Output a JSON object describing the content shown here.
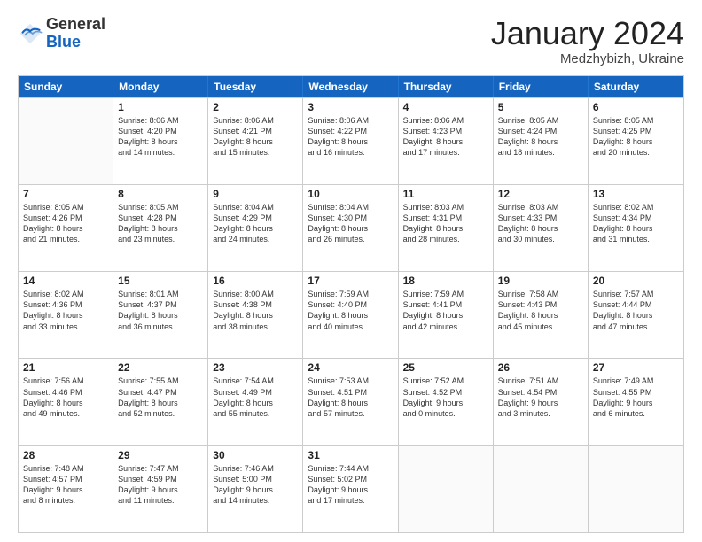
{
  "header": {
    "logo_general": "General",
    "logo_blue": "Blue",
    "month_title": "January 2024",
    "location": "Medzhybizh, Ukraine"
  },
  "days_of_week": [
    "Sunday",
    "Monday",
    "Tuesday",
    "Wednesday",
    "Thursday",
    "Friday",
    "Saturday"
  ],
  "weeks": [
    [
      {
        "day": "",
        "empty": true
      },
      {
        "day": "1",
        "sunrise": "Sunrise: 8:06 AM",
        "sunset": "Sunset: 4:20 PM",
        "daylight": "Daylight: 8 hours",
        "daylight2": "and 14 minutes."
      },
      {
        "day": "2",
        "sunrise": "Sunrise: 8:06 AM",
        "sunset": "Sunset: 4:21 PM",
        "daylight": "Daylight: 8 hours",
        "daylight2": "and 15 minutes."
      },
      {
        "day": "3",
        "sunrise": "Sunrise: 8:06 AM",
        "sunset": "Sunset: 4:22 PM",
        "daylight": "Daylight: 8 hours",
        "daylight2": "and 16 minutes."
      },
      {
        "day": "4",
        "sunrise": "Sunrise: 8:06 AM",
        "sunset": "Sunset: 4:23 PM",
        "daylight": "Daylight: 8 hours",
        "daylight2": "and 17 minutes."
      },
      {
        "day": "5",
        "sunrise": "Sunrise: 8:05 AM",
        "sunset": "Sunset: 4:24 PM",
        "daylight": "Daylight: 8 hours",
        "daylight2": "and 18 minutes."
      },
      {
        "day": "6",
        "sunrise": "Sunrise: 8:05 AM",
        "sunset": "Sunset: 4:25 PM",
        "daylight": "Daylight: 8 hours",
        "daylight2": "and 20 minutes."
      }
    ],
    [
      {
        "day": "7",
        "sunrise": "Sunrise: 8:05 AM",
        "sunset": "Sunset: 4:26 PM",
        "daylight": "Daylight: 8 hours",
        "daylight2": "and 21 minutes."
      },
      {
        "day": "8",
        "sunrise": "Sunrise: 8:05 AM",
        "sunset": "Sunset: 4:28 PM",
        "daylight": "Daylight: 8 hours",
        "daylight2": "and 23 minutes."
      },
      {
        "day": "9",
        "sunrise": "Sunrise: 8:04 AM",
        "sunset": "Sunset: 4:29 PM",
        "daylight": "Daylight: 8 hours",
        "daylight2": "and 24 minutes."
      },
      {
        "day": "10",
        "sunrise": "Sunrise: 8:04 AM",
        "sunset": "Sunset: 4:30 PM",
        "daylight": "Daylight: 8 hours",
        "daylight2": "and 26 minutes."
      },
      {
        "day": "11",
        "sunrise": "Sunrise: 8:03 AM",
        "sunset": "Sunset: 4:31 PM",
        "daylight": "Daylight: 8 hours",
        "daylight2": "and 28 minutes."
      },
      {
        "day": "12",
        "sunrise": "Sunrise: 8:03 AM",
        "sunset": "Sunset: 4:33 PM",
        "daylight": "Daylight: 8 hours",
        "daylight2": "and 30 minutes."
      },
      {
        "day": "13",
        "sunrise": "Sunrise: 8:02 AM",
        "sunset": "Sunset: 4:34 PM",
        "daylight": "Daylight: 8 hours",
        "daylight2": "and 31 minutes."
      }
    ],
    [
      {
        "day": "14",
        "sunrise": "Sunrise: 8:02 AM",
        "sunset": "Sunset: 4:36 PM",
        "daylight": "Daylight: 8 hours",
        "daylight2": "and 33 minutes."
      },
      {
        "day": "15",
        "sunrise": "Sunrise: 8:01 AM",
        "sunset": "Sunset: 4:37 PM",
        "daylight": "Daylight: 8 hours",
        "daylight2": "and 36 minutes."
      },
      {
        "day": "16",
        "sunrise": "Sunrise: 8:00 AM",
        "sunset": "Sunset: 4:38 PM",
        "daylight": "Daylight: 8 hours",
        "daylight2": "and 38 minutes."
      },
      {
        "day": "17",
        "sunrise": "Sunrise: 7:59 AM",
        "sunset": "Sunset: 4:40 PM",
        "daylight": "Daylight: 8 hours",
        "daylight2": "and 40 minutes."
      },
      {
        "day": "18",
        "sunrise": "Sunrise: 7:59 AM",
        "sunset": "Sunset: 4:41 PM",
        "daylight": "Daylight: 8 hours",
        "daylight2": "and 42 minutes."
      },
      {
        "day": "19",
        "sunrise": "Sunrise: 7:58 AM",
        "sunset": "Sunset: 4:43 PM",
        "daylight": "Daylight: 8 hours",
        "daylight2": "and 45 minutes."
      },
      {
        "day": "20",
        "sunrise": "Sunrise: 7:57 AM",
        "sunset": "Sunset: 4:44 PM",
        "daylight": "Daylight: 8 hours",
        "daylight2": "and 47 minutes."
      }
    ],
    [
      {
        "day": "21",
        "sunrise": "Sunrise: 7:56 AM",
        "sunset": "Sunset: 4:46 PM",
        "daylight": "Daylight: 8 hours",
        "daylight2": "and 49 minutes."
      },
      {
        "day": "22",
        "sunrise": "Sunrise: 7:55 AM",
        "sunset": "Sunset: 4:47 PM",
        "daylight": "Daylight: 8 hours",
        "daylight2": "and 52 minutes."
      },
      {
        "day": "23",
        "sunrise": "Sunrise: 7:54 AM",
        "sunset": "Sunset: 4:49 PM",
        "daylight": "Daylight: 8 hours",
        "daylight2": "and 55 minutes."
      },
      {
        "day": "24",
        "sunrise": "Sunrise: 7:53 AM",
        "sunset": "Sunset: 4:51 PM",
        "daylight": "Daylight: 8 hours",
        "daylight2": "and 57 minutes."
      },
      {
        "day": "25",
        "sunrise": "Sunrise: 7:52 AM",
        "sunset": "Sunset: 4:52 PM",
        "daylight": "Daylight: 9 hours",
        "daylight2": "and 0 minutes."
      },
      {
        "day": "26",
        "sunrise": "Sunrise: 7:51 AM",
        "sunset": "Sunset: 4:54 PM",
        "daylight": "Daylight: 9 hours",
        "daylight2": "and 3 minutes."
      },
      {
        "day": "27",
        "sunrise": "Sunrise: 7:49 AM",
        "sunset": "Sunset: 4:55 PM",
        "daylight": "Daylight: 9 hours",
        "daylight2": "and 6 minutes."
      }
    ],
    [
      {
        "day": "28",
        "sunrise": "Sunrise: 7:48 AM",
        "sunset": "Sunset: 4:57 PM",
        "daylight": "Daylight: 9 hours",
        "daylight2": "and 8 minutes."
      },
      {
        "day": "29",
        "sunrise": "Sunrise: 7:47 AM",
        "sunset": "Sunset: 4:59 PM",
        "daylight": "Daylight: 9 hours",
        "daylight2": "and 11 minutes."
      },
      {
        "day": "30",
        "sunrise": "Sunrise: 7:46 AM",
        "sunset": "Sunset: 5:00 PM",
        "daylight": "Daylight: 9 hours",
        "daylight2": "and 14 minutes."
      },
      {
        "day": "31",
        "sunrise": "Sunrise: 7:44 AM",
        "sunset": "Sunset: 5:02 PM",
        "daylight": "Daylight: 9 hours",
        "daylight2": "and 17 minutes."
      },
      {
        "day": "",
        "empty": true
      },
      {
        "day": "",
        "empty": true
      },
      {
        "day": "",
        "empty": true
      }
    ]
  ]
}
